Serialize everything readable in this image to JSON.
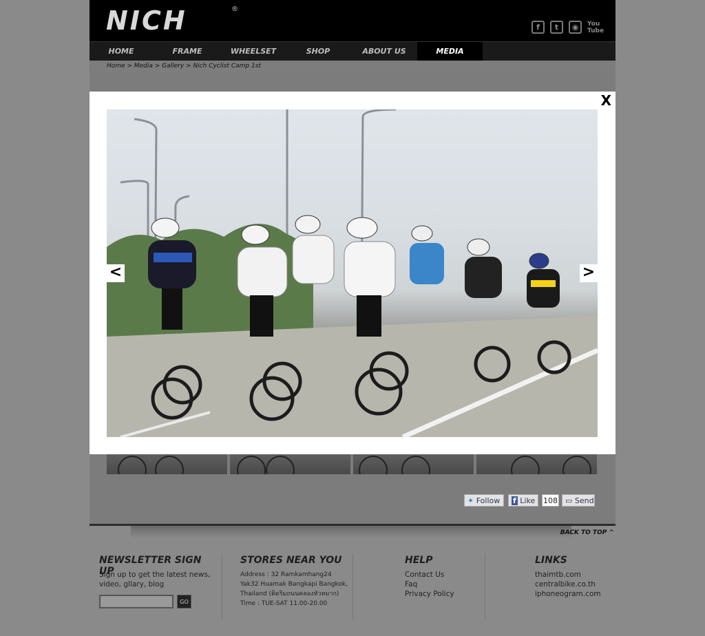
{
  "brand": {
    "logo": "NICH",
    "reg": "®"
  },
  "social": [
    {
      "icon": "facebook-icon",
      "glyph": "f"
    },
    {
      "icon": "twitter-icon",
      "glyph": "t"
    },
    {
      "icon": "instagram-icon",
      "glyph": "◉"
    },
    {
      "icon": "youtube-icon",
      "glyph": "You Tube"
    }
  ],
  "nav": {
    "home": "HOME",
    "frame": "FRAME",
    "wheelset": "WHEELSET",
    "shop": "SHOP",
    "about": "ABOUT US",
    "media": "MEDIA"
  },
  "breadcrumb": "Home > Media > Gallery > Nich Cyclist Camp 1st",
  "modal": {
    "close": "X",
    "prev": "<",
    "next": ">"
  },
  "share": {
    "follow": "Follow",
    "like": "Like",
    "like_count": "108",
    "send": "Send"
  },
  "back_to_top": "BACK TO TOP ^",
  "newsletter": {
    "title": "NEWSLETTER SIGN UP",
    "text": "Sign up to get the latest news, video, gllary, blog",
    "go": "GO",
    "placeholder": ""
  },
  "stores": {
    "title": "STORES NEAR YOU",
    "line1": "Address : 32 Ramkamhang24",
    "line2": "Yak32 Huamak Bangkapi Bangkok,",
    "line3": "Thailand (ติดริมถนนคลองหัวหมาก)",
    "line4": "Time : TUE-SAT 11.00-20.00"
  },
  "help": {
    "title": "HELP",
    "contact": "Contact Us",
    "faq": "Faq",
    "privacy": "Privacy  Policy"
  },
  "links": {
    "title": "LINKS",
    "l1": "thaimtb.com",
    "l2": "centralbike.co.th",
    "l3": "iphoneogram.com"
  }
}
